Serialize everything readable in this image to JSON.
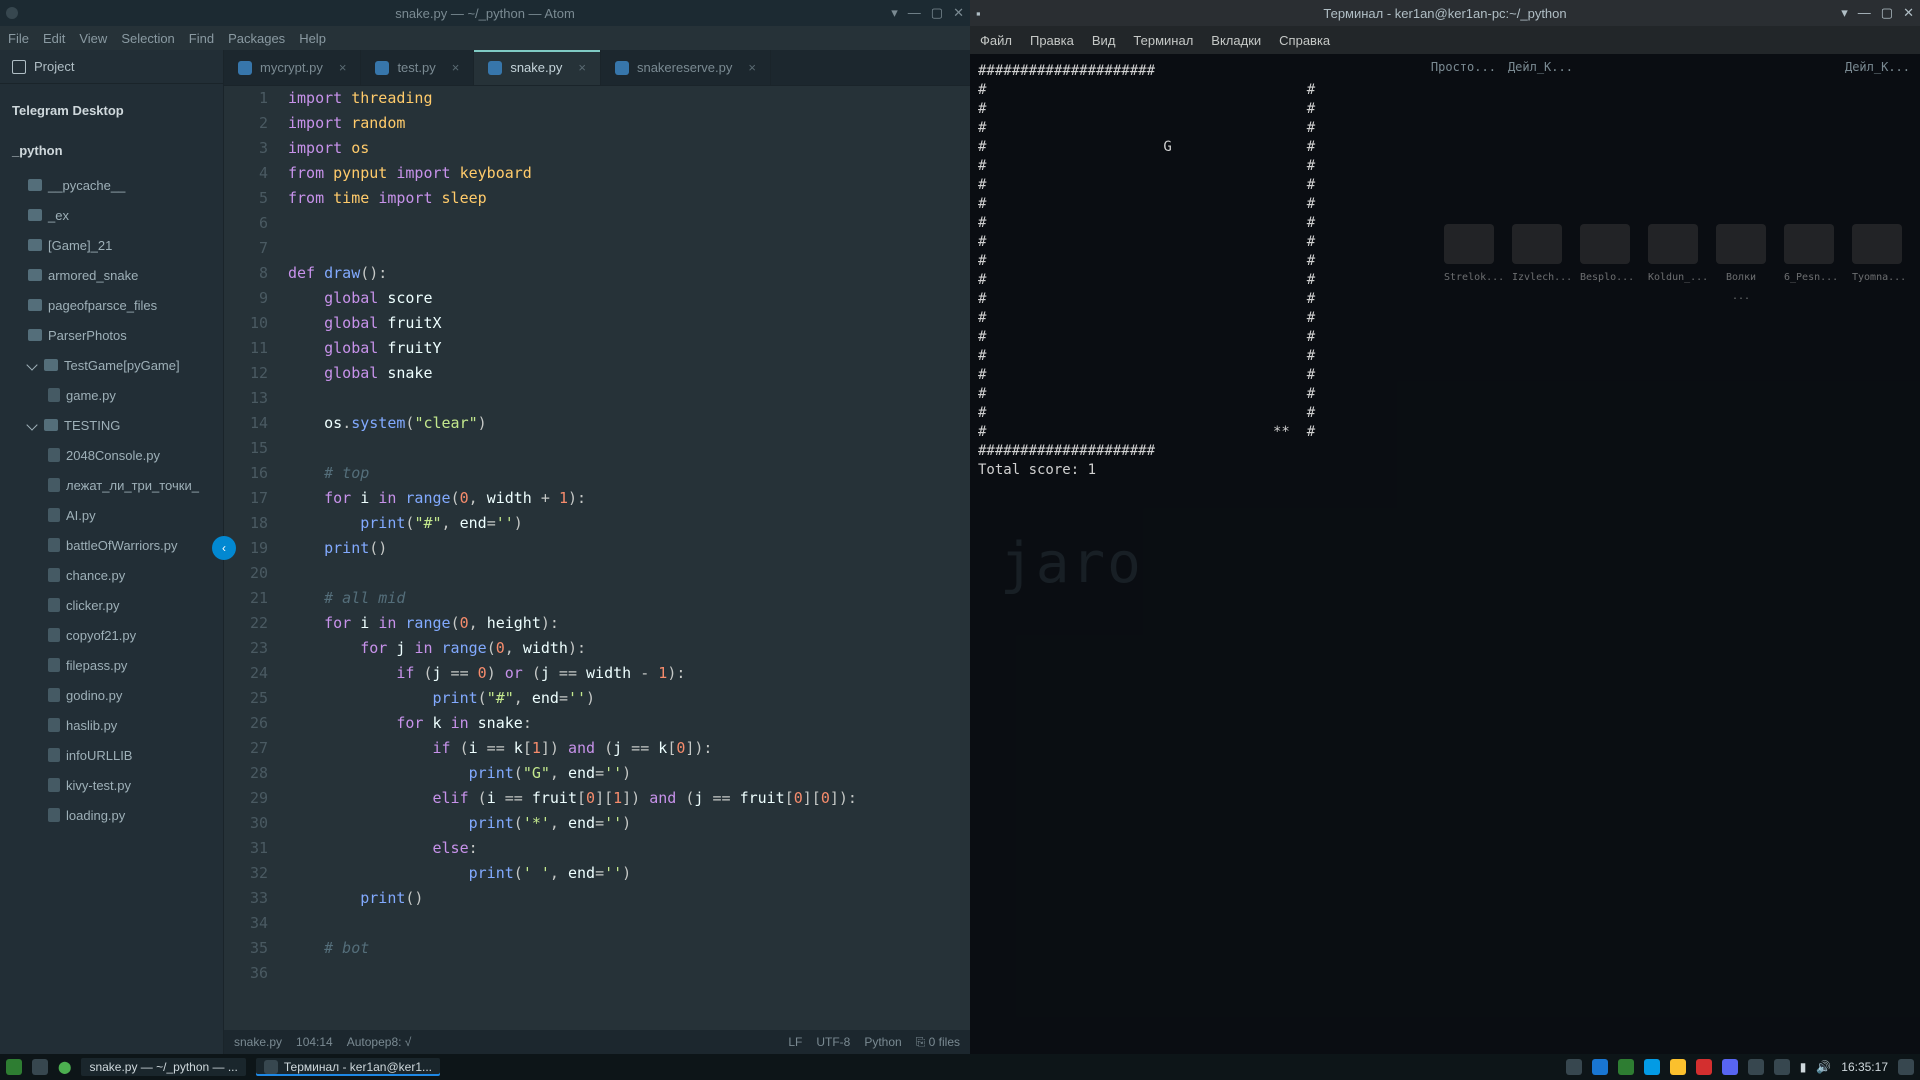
{
  "atom": {
    "title": "snake.py — ~/_python — Atom",
    "menu": [
      "File",
      "Edit",
      "View",
      "Selection",
      "Find",
      "Packages",
      "Help"
    ],
    "project": {
      "label": "Project",
      "telegram": "Telegram Desktop",
      "root": "_python",
      "folders": [
        "__pycache__",
        "_ex",
        "[Game]_21",
        "armored_snake",
        "pageofparsce_files",
        "ParserPhotos",
        "TestGame[pyGame]"
      ],
      "subfile": "game.py",
      "folderTesting": "TESTING",
      "files": [
        "2048Console.py",
        "лежат_ли_три_точки_",
        "AI.py",
        "battleOfWarriors.py",
        "chance.py",
        "clicker.py",
        "copyof21.py",
        "filepass.py",
        "godino.py",
        "haslib.py",
        "infoURLLIB",
        "kivy-test.py",
        "loading.py"
      ]
    },
    "tabs": [
      {
        "label": "mycrypt.py",
        "active": false
      },
      {
        "label": "test.py",
        "active": false
      },
      {
        "label": "snake.py",
        "active": true
      },
      {
        "label": "snakereserve.py",
        "active": false
      }
    ],
    "status": {
      "file": "snake.py",
      "cursor": "104:14",
      "autopep": "Autopep8: √",
      "lf": "LF",
      "enc": "UTF-8",
      "lang": "Python",
      "files": "0 files"
    }
  },
  "code": {
    "lines": [
      {
        "n": "1",
        "html": "<span class='kw'>import</span> <span class='mod'>threading</span>"
      },
      {
        "n": "2",
        "html": "<span class='kw'>import</span> <span class='mod'>random</span>"
      },
      {
        "n": "3",
        "html": "<span class='kw'>import</span> <span class='mod'>os</span>"
      },
      {
        "n": "4",
        "html": "<span class='kw'>from</span> <span class='mod'>pynput</span> <span class='kw'>import</span> <span class='mod'>keyboard</span>"
      },
      {
        "n": "5",
        "html": "<span class='kw'>from</span> <span class='mod'>time</span> <span class='kw'>import</span> <span class='mod'>sleep</span>"
      },
      {
        "n": "6",
        "html": ""
      },
      {
        "n": "7",
        "html": ""
      },
      {
        "n": "8",
        "html": "<span class='kw'>def</span> <span class='fn'>draw</span>():"
      },
      {
        "n": "9",
        "html": "    <span class='kw'>global</span> <span class='var'>score</span>"
      },
      {
        "n": "10",
        "html": "    <span class='kw'>global</span> <span class='var'>fruitX</span>"
      },
      {
        "n": "11",
        "html": "    <span class='kw'>global</span> <span class='var'>fruitY</span>"
      },
      {
        "n": "12",
        "html": "    <span class='kw'>global</span> <span class='var'>snake</span>"
      },
      {
        "n": "13",
        "html": ""
      },
      {
        "n": "14",
        "html": "    <span class='var'>os</span>.<span class='fn'>system</span>(<span class='str'>\"clear\"</span>)"
      },
      {
        "n": "15",
        "html": ""
      },
      {
        "n": "16",
        "html": "    <span class='cm'># top</span>"
      },
      {
        "n": "17",
        "html": "    <span class='kw'>for</span> <span class='var'>i</span> <span class='kw'>in</span> <span class='fn'>range</span>(<span class='num'>0</span>, <span class='var'>width</span> + <span class='num'>1</span>):"
      },
      {
        "n": "18",
        "html": "        <span class='fn'>print</span>(<span class='str'>\"#\"</span>, <span class='var'>end</span>=<span class='str'>''</span>)"
      },
      {
        "n": "19",
        "html": "    <span class='fn'>print</span>()"
      },
      {
        "n": "20",
        "html": ""
      },
      {
        "n": "21",
        "html": "    <span class='cm'># all mid</span>"
      },
      {
        "n": "22",
        "html": "    <span class='kw'>for</span> <span class='var'>i</span> <span class='kw'>in</span> <span class='fn'>range</span>(<span class='num'>0</span>, <span class='var'>height</span>):"
      },
      {
        "n": "23",
        "html": "        <span class='kw'>for</span> <span class='var'>j</span> <span class='kw'>in</span> <span class='fn'>range</span>(<span class='num'>0</span>, <span class='var'>width</span>):"
      },
      {
        "n": "24",
        "html": "            <span class='kw'>if</span> (<span class='var'>j</span> == <span class='num'>0</span>) <span class='kw'>or</span> (<span class='var'>j</span> == <span class='var'>width</span> - <span class='num'>1</span>):"
      },
      {
        "n": "25",
        "html": "                <span class='fn'>print</span>(<span class='str'>\"#\"</span>, <span class='var'>end</span>=<span class='str'>''</span>)"
      },
      {
        "n": "26",
        "html": "            <span class='kw'>for</span> <span class='var'>k</span> <span class='kw'>in</span> <span class='var'>snake</span>:"
      },
      {
        "n": "27",
        "html": "                <span class='kw'>if</span> (<span class='var'>i</span> == <span class='var'>k</span>[<span class='num'>1</span>]) <span class='kw'>and</span> (<span class='var'>j</span> == <span class='var'>k</span>[<span class='num'>0</span>]):"
      },
      {
        "n": "28",
        "html": "                    <span class='fn'>print</span>(<span class='str'>\"G\"</span>, <span class='var'>end</span>=<span class='str'>''</span>)"
      },
      {
        "n": "29",
        "html": "                <span class='kw'>elif</span> (<span class='var'>i</span> == <span class='var'>fruit</span>[<span class='num'>0</span>][<span class='num'>1</span>]) <span class='kw'>and</span> (<span class='var'>j</span> == <span class='var'>fruit</span>[<span class='num'>0</span>][<span class='num'>0</span>]):"
      },
      {
        "n": "30",
        "html": "                    <span class='fn'>print</span>(<span class='str'>'*'</span>, <span class='var'>end</span>=<span class='str'>''</span>)"
      },
      {
        "n": "31",
        "html": "                <span class='kw'>else</span>:"
      },
      {
        "n": "32",
        "html": "                    <span class='fn'>print</span>(<span class='str'>' '</span>, <span class='var'>end</span>=<span class='str'>''</span>)"
      },
      {
        "n": "33",
        "html": "        <span class='fn'>print</span>()"
      },
      {
        "n": "34",
        "html": ""
      },
      {
        "n": "35",
        "html": "    <span class='cm'># bot</span>"
      },
      {
        "n": "36",
        "html": ""
      }
    ]
  },
  "terminal": {
    "title": "Терминал - ker1an@ker1an-pc:~/_python",
    "menu": [
      "Файл",
      "Правка",
      "Вид",
      "Терминал",
      "Вкладки",
      "Справка"
    ],
    "topright": [
      "Просто...",
      "Дейл_К..."
    ],
    "toprightFar": "Дейл_К...",
    "output": "#####################\n#                                      #\n#                                      #\n#                                      #\n#                     G                #\n#                                      #\n#                                      #\n#                                      #\n#                                      #\n#                                      #\n#                                      #\n#                                      #\n#                                      #\n#                                      #\n#                                      #\n#                                      #\n#                                      #\n#                                      #\n#                                      #\n#                                  **  #\n#####################\nTotal score: 1\n",
    "desk": [
      "Strelok...",
      "Izvlech...",
      "Besplo...",
      "Koldun_...",
      "Волки ...",
      "6_Pesn...",
      "Tyomna..."
    ]
  },
  "taskbar": {
    "apps": [
      "snake.py — ~/_python — ...",
      "Терминал - ker1an@ker1..."
    ],
    "time": "16:35:17"
  }
}
